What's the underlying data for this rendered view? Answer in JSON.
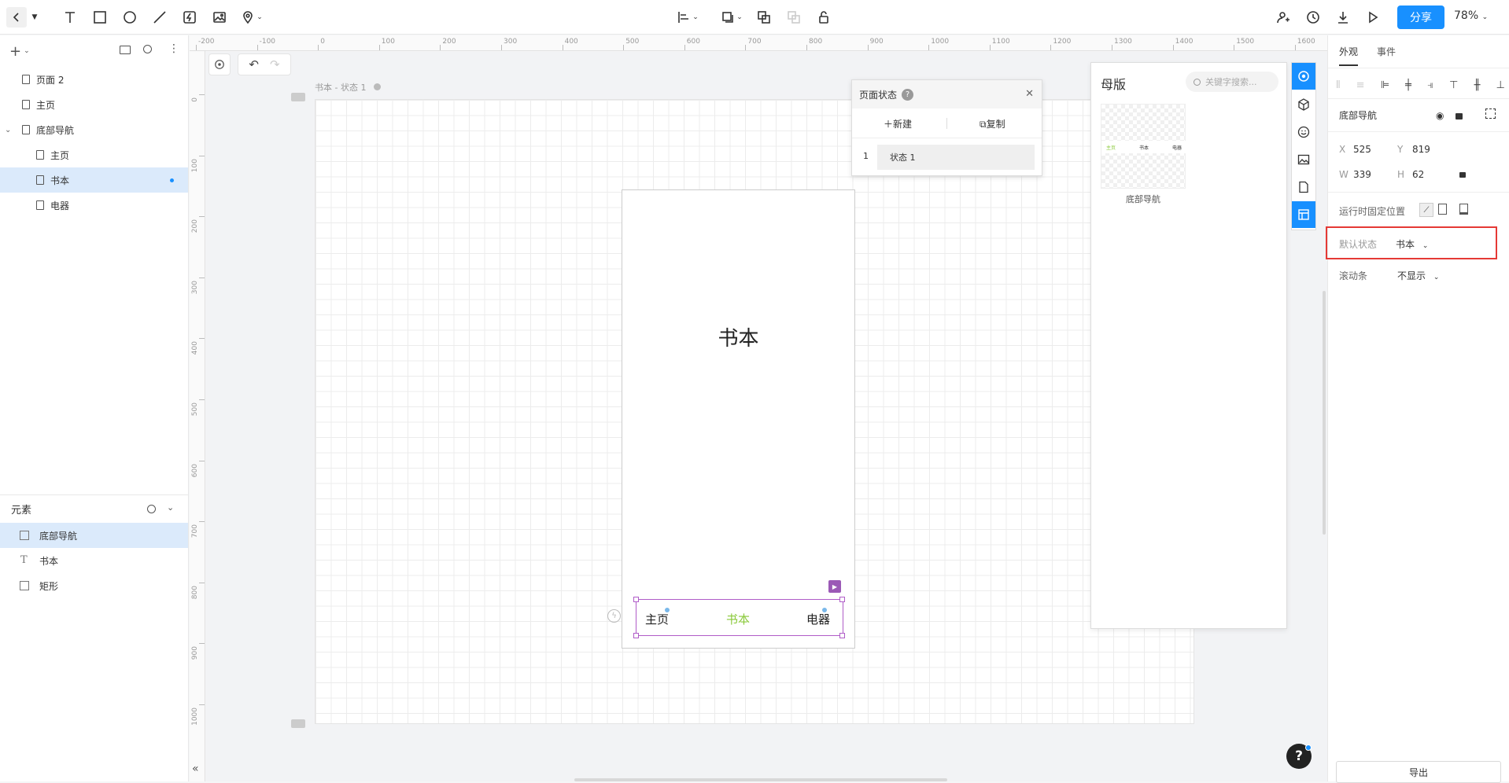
{
  "toolbar": {
    "share": "分享",
    "zoom": "78%"
  },
  "pages": [
    {
      "label": "页面 2"
    },
    {
      "label": "主页"
    },
    {
      "label": "底部导航"
    },
    {
      "label": "主页"
    },
    {
      "label": "书本"
    },
    {
      "label": "电器"
    }
  ],
  "elements": {
    "header": "元素",
    "items": [
      {
        "label": "底部导航",
        "icon": "layout-icon"
      },
      {
        "label": "书本",
        "icon": "text-icon"
      },
      {
        "label": "矩形",
        "icon": "rect-icon"
      }
    ]
  },
  "ruler": {
    "h_ticks": [
      "-200",
      "-100",
      "0",
      "100",
      "200",
      "300",
      "400",
      "500",
      "600",
      "700",
      "800",
      "900",
      "1000",
      "1100",
      "1200",
      "1300",
      "1400",
      "1500",
      "1600"
    ],
    "v_ticks": [
      "0",
      "100",
      "200",
      "300",
      "400",
      "500",
      "600",
      "700",
      "800",
      "900",
      "1000"
    ]
  },
  "canvas": {
    "artboard_label": "书本 - 状态 1",
    "phone_title": "书本",
    "nav": {
      "left": "主页",
      "center": "书本",
      "right": "电器"
    },
    "nav_colors": {
      "active": "#8ac93a",
      "normal": "#222222",
      "selection": "#b05cc8"
    }
  },
  "state_panel": {
    "title": "页面状态",
    "new": "新建",
    "copy": "复制",
    "row_index": "1",
    "row_label": "状态 1"
  },
  "master_panel": {
    "title": "母版",
    "search_placeholder": "关键字搜索...",
    "thumb_label": "底部导航",
    "thumb_nav": [
      "主页",
      "书本",
      "电器"
    ]
  },
  "rightpanel": {
    "tabs": [
      "外观",
      "事件"
    ],
    "component_name": "底部导航",
    "x_label": "X",
    "x": "525",
    "y_label": "Y",
    "y": "819",
    "w_label": "W",
    "w": "339",
    "h_label": "H",
    "h": "62",
    "fixed_label": "运行时固定位置",
    "default_state_label": "默认状态",
    "default_state_value": "书本",
    "scrollbar_label": "滚动条",
    "scrollbar_value": "不显示",
    "export": "导出"
  },
  "colors": {
    "accent": "#1890ff",
    "highlight_border": "#e53935"
  }
}
